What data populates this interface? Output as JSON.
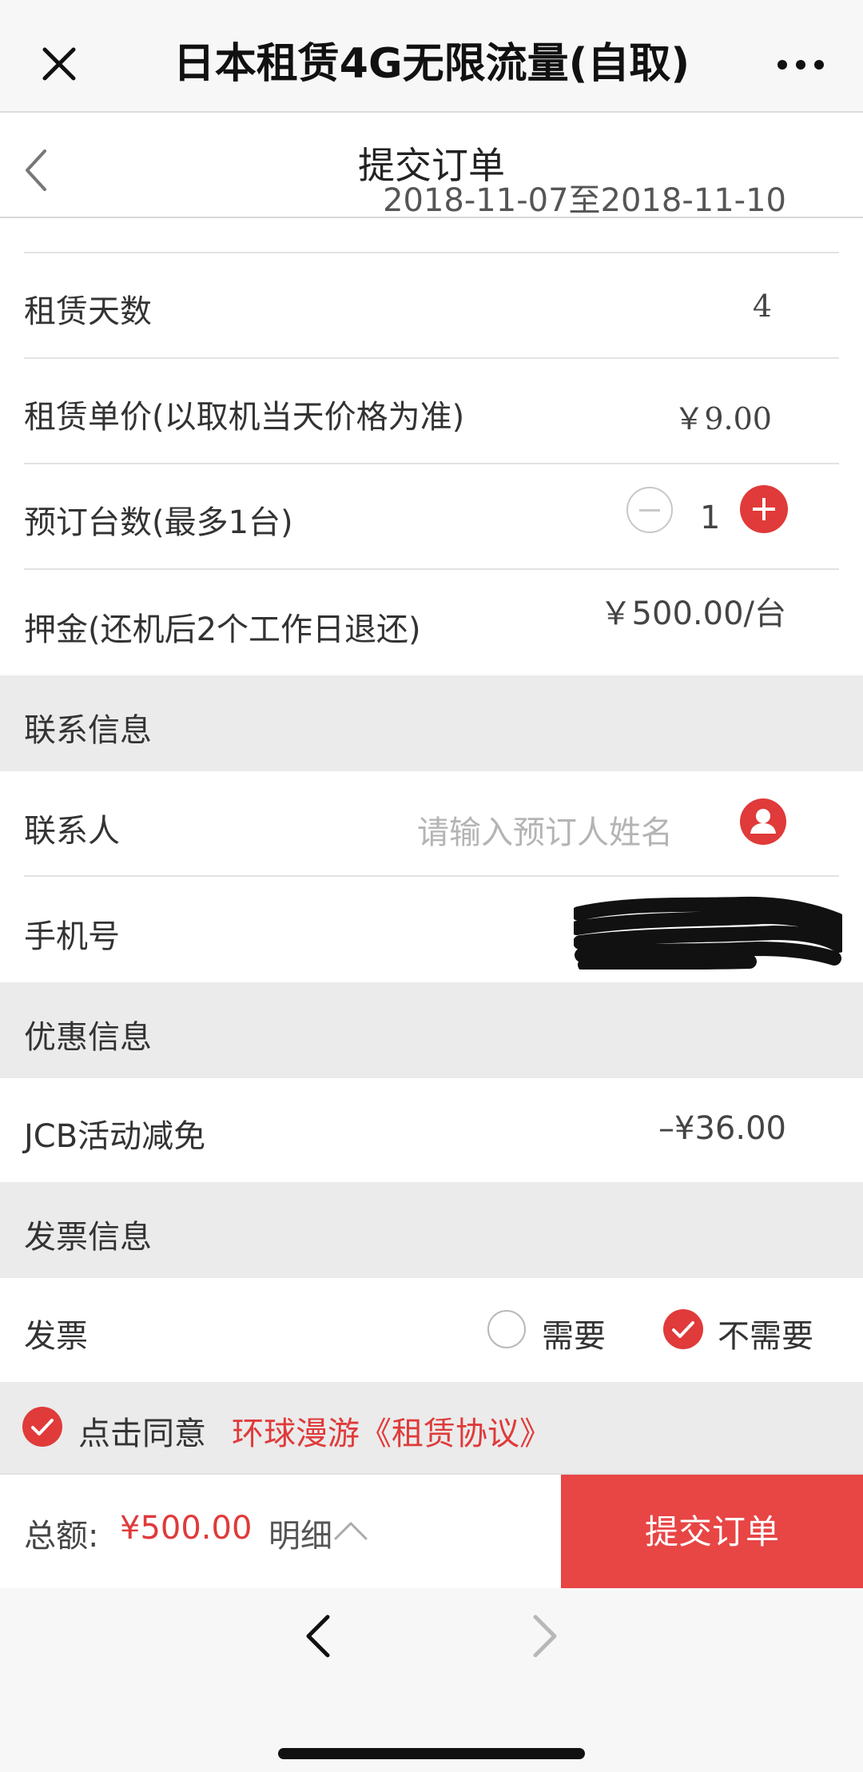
{
  "topbar": {
    "title": "日本租赁4G无限流量(自取)",
    "left_icon": "close-icon",
    "right_icon": "more-icon"
  },
  "header": {
    "title": "提交订单",
    "dates": "2018-11-07至2018-11-10"
  },
  "rows": {
    "days": {
      "label": "租赁天数",
      "value": "4"
    },
    "unit_price": {
      "label": "租赁单价(以取机当天价格为准)",
      "value": "￥9.00"
    },
    "quantity": {
      "label": "预订台数(最多1台)",
      "value": "1"
    },
    "deposit": {
      "label": "押金(还机后2个工作日退还)",
      "value": "￥500.00/台"
    }
  },
  "contact": {
    "section": "联系信息",
    "name_label": "联系人",
    "name_placeholder": "请输入预订人姓名",
    "phone_label": "手机号"
  },
  "discount": {
    "section": "优惠信息",
    "label": "JCB活动减免",
    "value": "–¥36.00"
  },
  "invoice": {
    "section": "发票信息",
    "label": "发票",
    "option_need": "需要",
    "option_no": "不需要",
    "selected": "不需要"
  },
  "agreement": {
    "prefix": "点击同意",
    "link": "环球漫游《租赁协议》",
    "checked": true
  },
  "bottom": {
    "total_label": "总额:",
    "total_amount": "¥500.00",
    "detail_label": "明细",
    "submit_label": "提交订单"
  },
  "colors": {
    "accent": "#e03a3a",
    "submit_bg": "#e84545",
    "section_bg": "#ebebeb"
  }
}
